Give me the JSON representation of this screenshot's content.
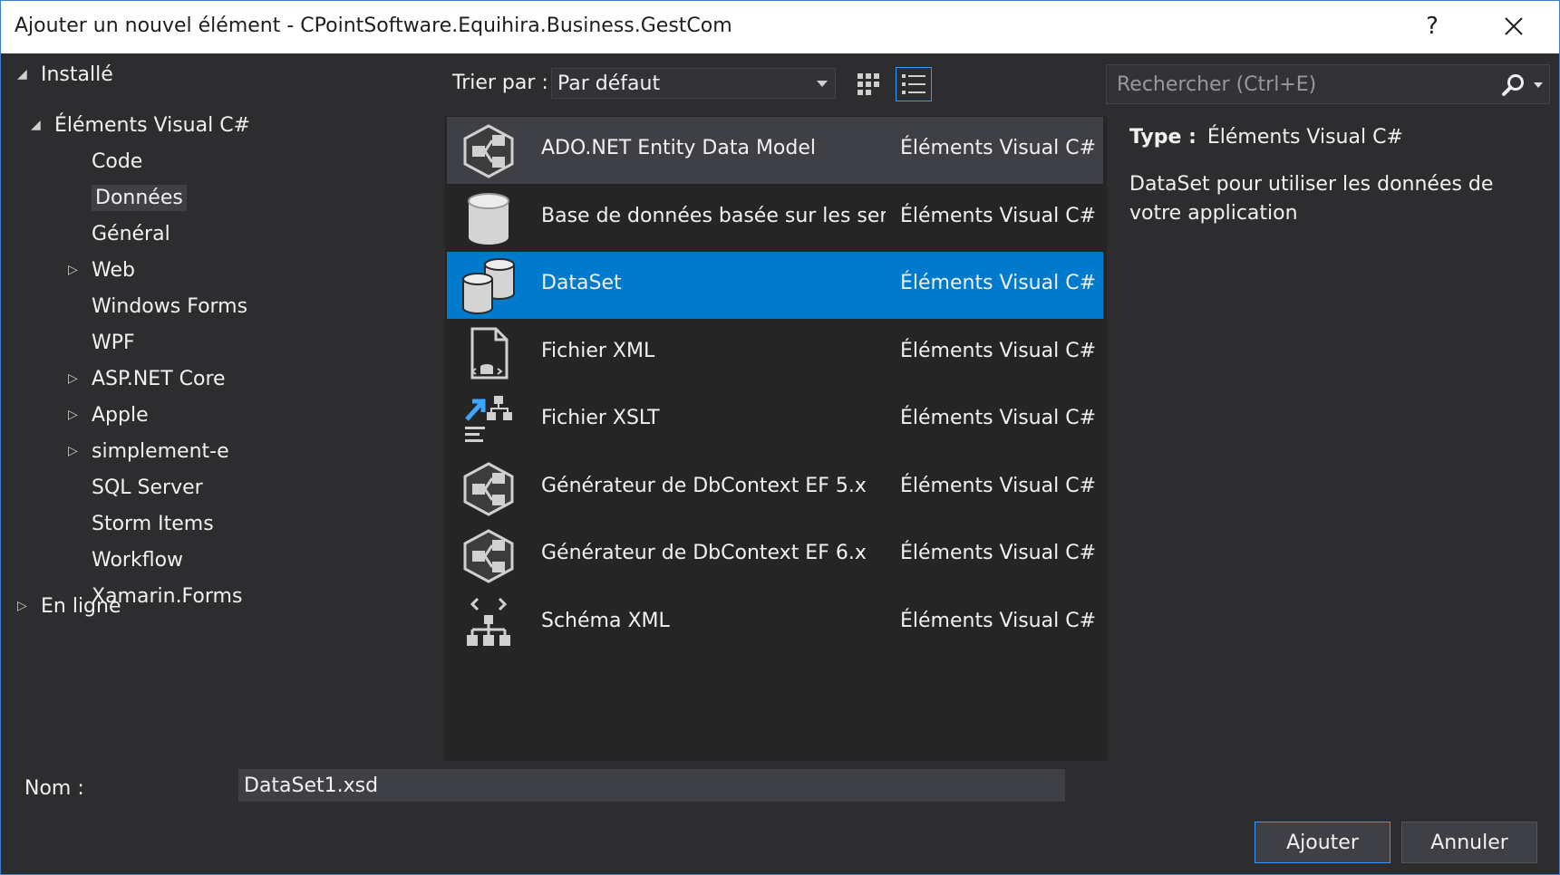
{
  "window": {
    "title": "Ajouter un nouvel élément - CPointSoftware.Equihira.Business.GestCom",
    "help_label": "?",
    "close_label": "✕"
  },
  "tree": {
    "installed": "Installé",
    "visual_cs": "Éléments Visual C#",
    "items": [
      {
        "label": "Code",
        "expandable": false,
        "selected": false
      },
      {
        "label": "Données",
        "expandable": false,
        "selected": true
      },
      {
        "label": "Général",
        "expandable": false,
        "selected": false
      },
      {
        "label": "Web",
        "expandable": true,
        "selected": false
      },
      {
        "label": "Windows Forms",
        "expandable": false,
        "selected": false
      },
      {
        "label": "WPF",
        "expandable": false,
        "selected": false
      },
      {
        "label": "ASP.NET Core",
        "expandable": true,
        "selected": false
      },
      {
        "label": "Apple",
        "expandable": true,
        "selected": false
      },
      {
        "label": "simplement-e",
        "expandable": true,
        "selected": false
      },
      {
        "label": "SQL Server",
        "expandable": false,
        "selected": false
      },
      {
        "label": "Storm Items",
        "expandable": false,
        "selected": false
      },
      {
        "label": "Workflow",
        "expandable": false,
        "selected": false
      },
      {
        "label": "Xamarin.Forms",
        "expandable": false,
        "selected": false
      }
    ],
    "online": "En ligne"
  },
  "toolbar": {
    "sort_label": "Trier par :",
    "sort_value": "Par défaut",
    "view_mode": "list"
  },
  "search": {
    "placeholder": "Rechercher (Ctrl+E)"
  },
  "templates": [
    {
      "name": "ADO.NET Entity Data Model",
      "category": "Éléments Visual C#",
      "icon": "entity-model-icon",
      "state": "hover"
    },
    {
      "name": "Base de données basée sur les ser...",
      "category": "Éléments Visual C#",
      "icon": "database-icon",
      "state": ""
    },
    {
      "name": "DataSet",
      "category": "Éléments Visual C#",
      "icon": "dataset-icon",
      "state": "selected"
    },
    {
      "name": "Fichier XML",
      "category": "Éléments Visual C#",
      "icon": "xml-file-icon",
      "state": ""
    },
    {
      "name": "Fichier XSLT",
      "category": "Éléments Visual C#",
      "icon": "xslt-file-icon",
      "state": ""
    },
    {
      "name": "Générateur de DbContext EF 5.x",
      "category": "Éléments Visual C#",
      "icon": "entity-model-icon",
      "state": ""
    },
    {
      "name": "Générateur de DbContext EF 6.x",
      "category": "Éléments Visual C#",
      "icon": "entity-model-icon",
      "state": ""
    },
    {
      "name": "Schéma XML",
      "category": "Éléments Visual C#",
      "icon": "xml-schema-icon",
      "state": ""
    }
  ],
  "details": {
    "type_label": "Type :",
    "type_value": "Éléments Visual C#",
    "description": "DataSet pour utiliser les données de votre application"
  },
  "footer": {
    "name_label": "Nom :",
    "name_value": "DataSet1.xsd",
    "add_label": "Ajouter",
    "cancel_label": "Annuler"
  },
  "colors": {
    "selection": "#007acc",
    "accent_border": "#3399ff",
    "background": "#2d2d30",
    "list_background": "#252526"
  }
}
